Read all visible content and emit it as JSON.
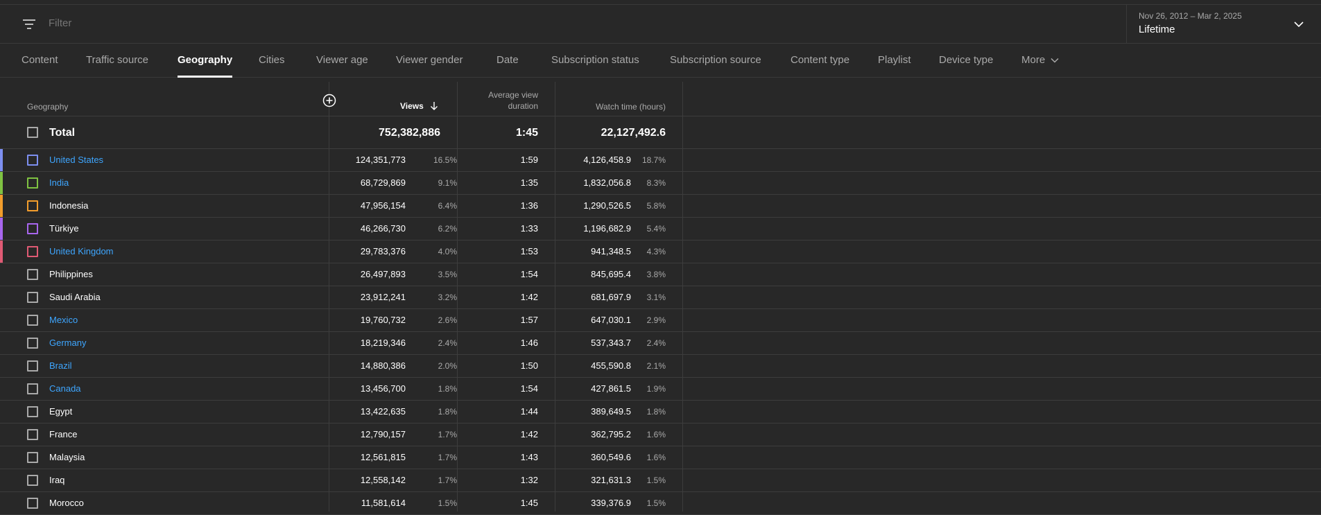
{
  "filter": {
    "placeholder": "Filter"
  },
  "date_range": {
    "range": "Nov 26, 2012 – Mar 2, 2025",
    "label": "Lifetime"
  },
  "tabs": [
    {
      "label": "Content",
      "active": false
    },
    {
      "label": "Traffic source",
      "active": false
    },
    {
      "label": "Geography",
      "active": true
    },
    {
      "label": "Cities",
      "active": false
    },
    {
      "label": "Viewer age",
      "active": false
    },
    {
      "label": "Viewer gender",
      "active": false
    },
    {
      "label": "Date",
      "active": false
    },
    {
      "label": "Subscription status",
      "active": false
    },
    {
      "label": "Subscription source",
      "active": false
    },
    {
      "label": "Content type",
      "active": false
    },
    {
      "label": "Playlist",
      "active": false
    },
    {
      "label": "Device type",
      "active": false
    },
    {
      "label": "More",
      "active": false
    }
  ],
  "table": {
    "headers": {
      "geography": "Geography",
      "views": "Views",
      "avd_line1": "Average view",
      "avd_line2": "duration",
      "watch_time": "Watch time (hours)"
    },
    "total": {
      "label": "Total",
      "views": "752,382,886",
      "avd": "1:45",
      "watch": "22,127,492.6"
    },
    "rows": [
      {
        "name": "United States",
        "link": true,
        "color": "#7d8ff0",
        "views": "124,351,773",
        "views_pct": "16.5%",
        "avd": "1:59",
        "watch": "4,126,458.9",
        "watch_pct": "18.7%"
      },
      {
        "name": "India",
        "link": true,
        "color": "#7fc242",
        "views": "68,729,869",
        "views_pct": "9.1%",
        "avd": "1:35",
        "watch": "1,832,056.8",
        "watch_pct": "8.3%"
      },
      {
        "name": "Indonesia",
        "link": false,
        "color": "#f29d2c",
        "views": "47,956,154",
        "views_pct": "6.4%",
        "avd": "1:36",
        "watch": "1,290,526.5",
        "watch_pct": "5.8%"
      },
      {
        "name": "Türkiye",
        "link": false,
        "color": "#a866ee",
        "views": "46,266,730",
        "views_pct": "6.2%",
        "avd": "1:33",
        "watch": "1,196,682.9",
        "watch_pct": "5.4%"
      },
      {
        "name": "United Kingdom",
        "link": true,
        "color": "#e05a74",
        "views": "29,783,376",
        "views_pct": "4.0%",
        "avd": "1:53",
        "watch": "941,348.5",
        "watch_pct": "4.3%"
      },
      {
        "name": "Philippines",
        "link": false,
        "color": "",
        "views": "26,497,893",
        "views_pct": "3.5%",
        "avd": "1:54",
        "watch": "845,695.4",
        "watch_pct": "3.8%"
      },
      {
        "name": "Saudi Arabia",
        "link": false,
        "color": "",
        "views": "23,912,241",
        "views_pct": "3.2%",
        "avd": "1:42",
        "watch": "681,697.9",
        "watch_pct": "3.1%"
      },
      {
        "name": "Mexico",
        "link": true,
        "color": "",
        "views": "19,760,732",
        "views_pct": "2.6%",
        "avd": "1:57",
        "watch": "647,030.1",
        "watch_pct": "2.9%"
      },
      {
        "name": "Germany",
        "link": true,
        "color": "",
        "views": "18,219,346",
        "views_pct": "2.4%",
        "avd": "1:46",
        "watch": "537,343.7",
        "watch_pct": "2.4%"
      },
      {
        "name": "Brazil",
        "link": true,
        "color": "",
        "views": "14,880,386",
        "views_pct": "2.0%",
        "avd": "1:50",
        "watch": "455,590.8",
        "watch_pct": "2.1%"
      },
      {
        "name": "Canada",
        "link": true,
        "color": "",
        "views": "13,456,700",
        "views_pct": "1.8%",
        "avd": "1:54",
        "watch": "427,861.5",
        "watch_pct": "1.9%"
      },
      {
        "name": "Egypt",
        "link": false,
        "color": "",
        "views": "13,422,635",
        "views_pct": "1.8%",
        "avd": "1:44",
        "watch": "389,649.5",
        "watch_pct": "1.8%"
      },
      {
        "name": "France",
        "link": false,
        "color": "",
        "views": "12,790,157",
        "views_pct": "1.7%",
        "avd": "1:42",
        "watch": "362,795.2",
        "watch_pct": "1.6%"
      },
      {
        "name": "Malaysia",
        "link": false,
        "color": "",
        "views": "12,561,815",
        "views_pct": "1.7%",
        "avd": "1:43",
        "watch": "360,549.6",
        "watch_pct": "1.6%"
      },
      {
        "name": "Iraq",
        "link": false,
        "color": "",
        "views": "12,558,142",
        "views_pct": "1.7%",
        "avd": "1:32",
        "watch": "321,631.3",
        "watch_pct": "1.5%"
      },
      {
        "name": "Morocco",
        "link": false,
        "color": "",
        "views": "11,581,614",
        "views_pct": "1.5%",
        "avd": "1:45",
        "watch": "339,376.9",
        "watch_pct": "1.5%"
      }
    ]
  }
}
